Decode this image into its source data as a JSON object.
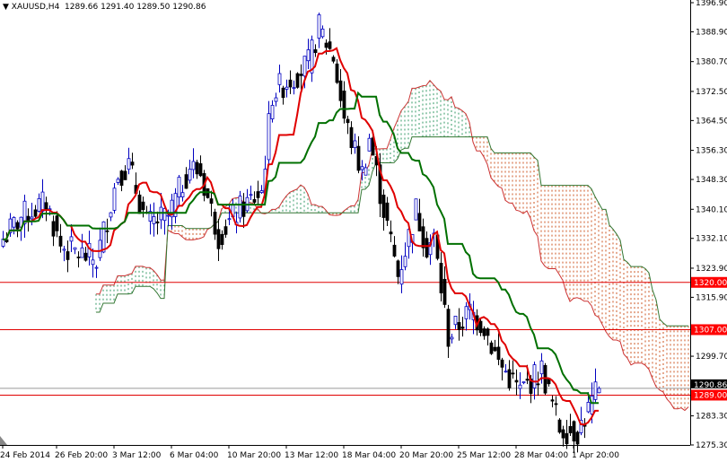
{
  "header": {
    "symbol": "XAUUSD,H4",
    "ohlc": "1289.66 1291.40 1289.50 1290.86"
  },
  "chart_data": {
    "type": "candlestick",
    "title": "XAUUSD,H4",
    "ylim": [
      1275.3,
      1396.9
    ],
    "y_ticks": [
      "1396.90",
      "1388.90",
      "1380.70",
      "1372.50",
      "1364.50",
      "1356.30",
      "1348.30",
      "1340.10",
      "1332.10",
      "1323.90",
      "1315.90",
      "1299.70",
      "1283.30",
      "1275.30"
    ],
    "x_ticks": [
      {
        "bar": 0,
        "label": "24 Feb 2014"
      },
      {
        "bar": 15,
        "label": "26 Feb 20:00"
      },
      {
        "bar": 31,
        "label": "3 Mar 12:00"
      },
      {
        "bar": 47,
        "label": "6 Mar 04:00"
      },
      {
        "bar": 63,
        "label": "10 Mar 20:00"
      },
      {
        "bar": 79,
        "label": "13 Mar 12:00"
      },
      {
        "bar": 95,
        "label": "18 Mar 04:00"
      },
      {
        "bar": 111,
        "label": "20 Mar 20:00"
      },
      {
        "bar": 127,
        "label": "25 Mar 12:00"
      },
      {
        "bar": 143,
        "label": "28 Mar 04:00"
      },
      {
        "bar": 159,
        "label": "1 Apr 20:00"
      }
    ],
    "close_keypoints": [
      [
        0,
        1332
      ],
      [
        5,
        1338
      ],
      [
        12,
        1342
      ],
      [
        16,
        1330
      ],
      [
        26,
        1326
      ],
      [
        32,
        1350
      ],
      [
        35,
        1352
      ],
      [
        40,
        1336
      ],
      [
        46,
        1338
      ],
      [
        52,
        1352
      ],
      [
        55,
        1350
      ],
      [
        60,
        1333
      ],
      [
        66,
        1340
      ],
      [
        72,
        1345
      ],
      [
        75,
        1372
      ],
      [
        85,
        1380
      ],
      [
        88,
        1390
      ],
      [
        92,
        1382
      ],
      [
        95,
        1365
      ],
      [
        100,
        1350
      ],
      [
        102,
        1360
      ],
      [
        106,
        1340
      ],
      [
        110,
        1322
      ],
      [
        115,
        1340
      ],
      [
        118,
        1330
      ],
      [
        120,
        1332
      ],
      [
        124,
        1305
      ],
      [
        130,
        1312
      ],
      [
        134,
        1308
      ],
      [
        138,
        1298
      ],
      [
        144,
        1290
      ],
      [
        150,
        1296
      ],
      [
        155,
        1280
      ],
      [
        160,
        1279
      ],
      [
        166,
        1290.86
      ]
    ],
    "horizontal_lines": [
      {
        "price": 1320.0,
        "label": "1320.00",
        "color": "#e00000"
      },
      {
        "price": 1307.0,
        "label": "1307.00",
        "color": "#e00000"
      },
      {
        "price": 1289.0,
        "label": "1289.00",
        "color": "#e00000"
      }
    ],
    "current_price": {
      "price": 1290.86,
      "label": "1290.86"
    },
    "indicators": {
      "tenkan_period": 9,
      "kijun_period": 26,
      "senkou_b_period": 52,
      "shift": 26
    },
    "colors": {
      "bull": "#0000c0",
      "bear": "#000000",
      "tenkan": "#e00000",
      "kijun": "#007000",
      "cloud_up": "#339966",
      "cloud_down": "#cc5522",
      "span_a": "#cc3333",
      "span_b": "#337733"
    }
  }
}
